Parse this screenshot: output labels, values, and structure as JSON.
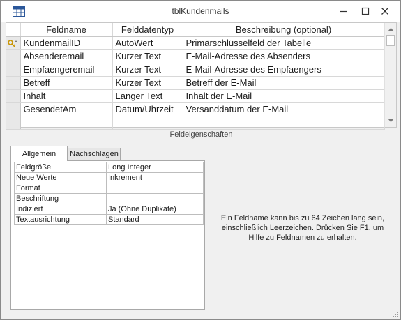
{
  "window": {
    "title": "tblKundenmails"
  },
  "grid": {
    "headers": {
      "name": "Feldname",
      "type": "Felddatentyp",
      "description": "Beschreibung (optional)"
    },
    "rows": [
      {
        "name": "KundenmailID",
        "type": "AutoWert",
        "description": "Primärschlüsselfeld der Tabelle",
        "primary_key": true
      },
      {
        "name": "Absenderemail",
        "type": "Kurzer Text",
        "description": "E-Mail-Adresse des Absenders"
      },
      {
        "name": "Empfaengeremail",
        "type": "Kurzer Text",
        "description": "E-Mail-Adresse des Empfaengers"
      },
      {
        "name": "Betreff",
        "type": "Kurzer Text",
        "description": "Betreff der E-Mail"
      },
      {
        "name": "Inhalt",
        "type": "Langer Text",
        "description": "Inhalt der E-Mail"
      },
      {
        "name": "GesendetAm",
        "type": "Datum/Uhrzeit",
        "description": "Versanddatum der E-Mail"
      }
    ]
  },
  "properties_section": {
    "label": "Feldeigenschaften",
    "tabs": [
      "Allgemein",
      "Nachschlagen"
    ],
    "active_tab": "Allgemein",
    "rows": [
      {
        "name": "Feldgröße",
        "value": "Long Integer"
      },
      {
        "name": "Neue Werte",
        "value": "Inkrement"
      },
      {
        "name": "Format",
        "value": ""
      },
      {
        "name": "Beschriftung",
        "value": ""
      },
      {
        "name": "Indiziert",
        "value": "Ja (Ohne Duplikate)"
      },
      {
        "name": "Textausrichtung",
        "value": "Standard"
      }
    ],
    "help_text": "Ein Feldname kann bis zu 64 Zeichen lang sein, einschließlich Leerzeichen. Drücken Sie F1, um Hilfe zu Feldnamen zu erhalten."
  },
  "icons": {
    "app": "table-icon",
    "primary_key": "key-icon",
    "minimize": "minimize-icon",
    "maximize": "maximize-icon",
    "close": "close-icon"
  },
  "colors": {
    "window_bg": "#f0f0f0",
    "grid_bg": "#ffffff",
    "selector_bg": "#e8e8e8",
    "key_icon": "#d6a000"
  }
}
